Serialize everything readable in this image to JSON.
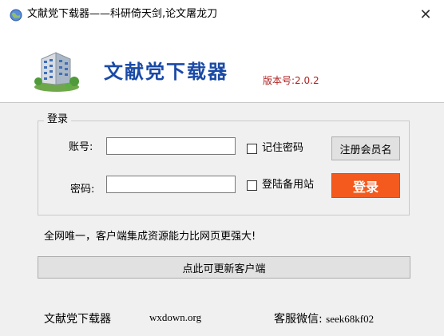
{
  "window": {
    "title": "文献党下载器——科研倚天剑,论文屠龙刀",
    "close_glyph": "✕"
  },
  "header": {
    "app_name": "文献党下载器",
    "version": "版本号:2.0.2"
  },
  "login": {
    "group_label": "登录",
    "account_label": "账号:",
    "account_value": "",
    "password_label": "密码:",
    "password_value": "",
    "remember_label": "记住密码",
    "backup_site_label": "登陆备用站",
    "register_button": "注册会员名",
    "login_button": "登录"
  },
  "slogan": "全网唯一，客户端集成资源能力比网页更强大!",
  "update_button": "点此可更新客户端",
  "footer": {
    "name": "文献党下载器",
    "site": "wxdown.org",
    "service_label": "客服微信:",
    "service_id": "seek68kf02"
  },
  "colors": {
    "header_title": "#1a4aa6",
    "version": "#b22222",
    "login_button": "#f45a1e"
  }
}
